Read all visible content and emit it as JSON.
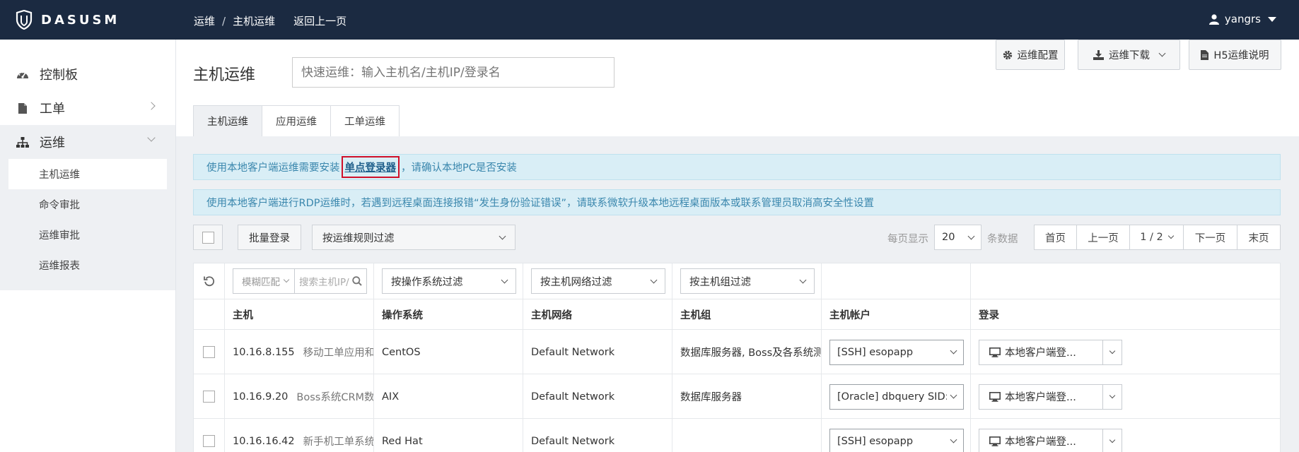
{
  "topbar": {
    "logo_text": "DASUSM",
    "breadcrumb": [
      "运维",
      "主机运维"
    ],
    "breadcrumb_sep": "/",
    "back_label": "返回上一页",
    "username": "yangrs"
  },
  "sidebar": {
    "items": [
      {
        "label": "控制板",
        "icon": "dashboard-icon"
      },
      {
        "label": "工单",
        "icon": "file-icon"
      },
      {
        "label": "运维",
        "icon": "sitemap-icon"
      }
    ],
    "sub_items": [
      "主机运维",
      "命令审批",
      "运维审批",
      "运维报表"
    ]
  },
  "main": {
    "title": "主机运维",
    "quick_search_placeholder": "快速运维：输入主机名/主机IP/登录名",
    "buttons": {
      "config": "运维配置",
      "download": "运维下载",
      "h5": "H5运维说明"
    },
    "tabs": [
      "主机运维",
      "应用运维",
      "工单运维"
    ],
    "alert1": {
      "prefix": "使用本地客户端运维需要安装",
      "link": "单点登录器",
      "suffix": "，请确认本地PC是否安装"
    },
    "alert2": "使用本地客户端进行RDP运维时，若遇到远程桌面连接报错“发生身份验证错误”，请联系微软升级本地远程桌面版本或联系管理员取消高安全性设置",
    "toolbar": {
      "batch_login": "批量登录",
      "rule_filter": "按运维规则过滤",
      "per_page_label": "每页显示",
      "per_page": "20",
      "records_label": "条数据",
      "first": "首页",
      "prev": "上一页",
      "page": "1 / 2",
      "next": "下一页",
      "last": "末页"
    },
    "filters": {
      "fuzzy": "模糊匹配",
      "search_placeholder": "搜索主机IP/",
      "os": "按操作系统过滤",
      "network": "按主机网络过滤",
      "group": "按主机组过滤"
    },
    "columns": [
      "主机",
      "操作系统",
      "主机网络",
      "主机组",
      "主机帐户",
      "登录"
    ],
    "rows": [
      {
        "ip": "10.16.8.155",
        "desc": "移动工单应用和...",
        "os": "CentOS",
        "network": "Default Network",
        "group": "数据库服务器, Boss及各系统测...",
        "account": "[SSH] esopapp",
        "login": "本地客户端登..."
      },
      {
        "ip": "10.16.9.20",
        "desc": "Boss系统CRM数据...",
        "os": "AIX",
        "network": "Default Network",
        "group": "数据库服务器",
        "account": "[Oracle] dbquery SID:crmd",
        "login": "本地客户端登..."
      },
      {
        "ip": "10.16.16.42",
        "desc": "新手机工单系统",
        "os": "Red Hat",
        "network": "Default Network",
        "group": "",
        "account": "[SSH] esopapp",
        "login": "本地客户端登..."
      }
    ]
  }
}
